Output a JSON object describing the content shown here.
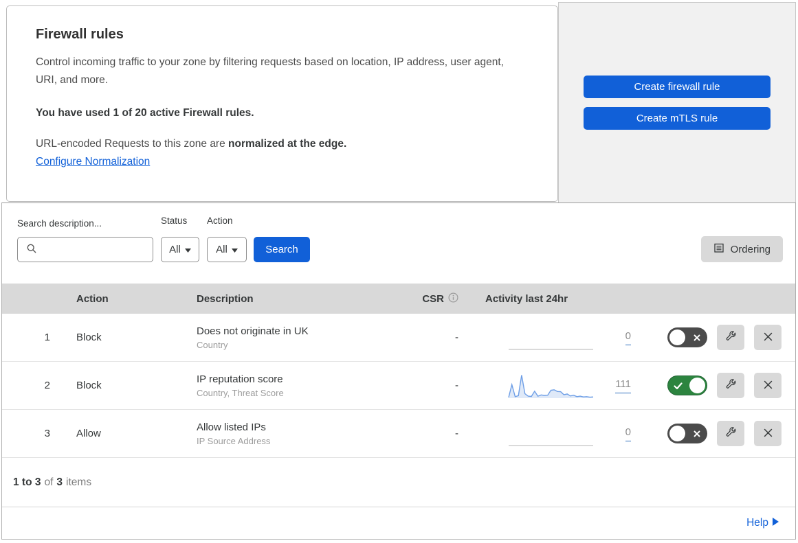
{
  "colors": {
    "accent_blue": "#1160d8",
    "toggle_on_green": "#2c843f",
    "toggle_off_gray": "#4b4b4b",
    "panel_gray": "#f1f1f1",
    "table_header_gray": "#d9d9d9",
    "sparkline_blue": "#6d9ee6",
    "sparkline_fill": "#dfe9f8"
  },
  "intro": {
    "title": "Firewall rules",
    "description": "Control incoming traffic to your zone by filtering requests based on location, IP address, user agent, URI, and more.",
    "usage": "You have used 1 of 20 active Firewall rules.",
    "normalization_prefix": "URL-encoded Requests to this zone are ",
    "normalization_bold": "normalized at the edge.",
    "normalization_link": "Configure Normalization"
  },
  "actions": {
    "create_firewall_rule": "Create firewall rule",
    "create_mtls_rule": "Create mTLS rule"
  },
  "filters": {
    "search_label": "Search description...",
    "status_label": "Status",
    "status_value": "All",
    "action_label": "Action",
    "action_value": "All",
    "search_button": "Search",
    "ordering_button": "Ordering"
  },
  "table": {
    "headers": {
      "action": "Action",
      "description": "Description",
      "csr": "CSR",
      "activity": "Activity last 24hr"
    },
    "rows": [
      {
        "index": "1",
        "action": "Block",
        "description": "Does not originate in UK",
        "fields": "Country",
        "csr": "-",
        "activity_count": "0",
        "enabled": false,
        "sparkline": []
      },
      {
        "index": "2",
        "action": "Block",
        "description": "IP reputation score",
        "fields": "Country, Threat Score",
        "csr": "-",
        "activity_count": "111",
        "enabled": true,
        "sparkline": [
          3,
          55,
          6,
          10,
          93,
          18,
          8,
          7,
          28,
          8,
          13,
          11,
          12,
          32,
          34,
          27,
          26,
          14,
          17,
          9,
          12,
          6,
          8,
          5,
          6,
          4,
          5
        ]
      },
      {
        "index": "3",
        "action": "Allow",
        "description": "Allow listed IPs",
        "fields": "IP Source Address",
        "csr": "-",
        "activity_count": "0",
        "enabled": false,
        "sparkline": []
      }
    ]
  },
  "pagination": {
    "range": "1 to 3",
    "of_label": "of",
    "total": "3",
    "items_label": "items"
  },
  "footer": {
    "help": "Help"
  }
}
